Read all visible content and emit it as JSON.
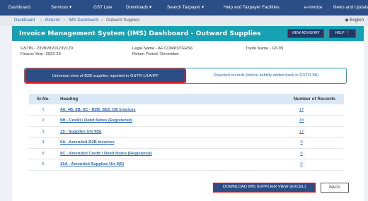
{
  "nav": {
    "items": [
      {
        "label": "Dashboard"
      },
      {
        "label": "Services ▾"
      },
      {
        "label": "GST Law"
      },
      {
        "label": "Downloads ▾"
      },
      {
        "label": "Search Taxpayer ▾"
      },
      {
        "label": "Help and Taxpayer Facilities"
      },
      {
        "label": "e-Invoice"
      },
      {
        "label": "News and Updates"
      }
    ]
  },
  "breadcrumb": {
    "items": [
      "Dashboard",
      "Returns",
      "IMS Dashboard",
      "Outward Supplies"
    ],
    "separator": "›"
  },
  "language": "English",
  "panel": {
    "title": "Invoice Management System (IMS) Dashboard - Outward Supplies",
    "view_advisory": "VIEW ADVISORY",
    "help": "HELP"
  },
  "info": {
    "gstin": "GSTIN - 23V8V8V0123V1Z0",
    "financial_year": "Financi Year -2022-23",
    "legal_name": "Legal Name - AF COMPUTERS6",
    "return_period": "Return Period -December",
    "trade_name": "Trade Name - GSTN"
  },
  "tabs": {
    "active": "Universal view of B2B supplies reported in GSTR-1/1A/IFF",
    "inactive": "Rejected records (where liability added back in GSTR 3B)"
  },
  "table": {
    "headers": {
      "sn": "Sr.No.",
      "heading": "Heading",
      "count": "Number of Records"
    },
    "rows": [
      {
        "sn": "1",
        "heading": "4A, 4B, 6B, 6C - B2B, SEZ, DE Invoices",
        "count": "17"
      },
      {
        "sn": "2",
        "heading": "9B - Credit / Debit Notes (Registered)",
        "count": "18"
      },
      {
        "sn": "3",
        "heading": "15 - Supplies U/s 9(5)",
        "count": "17"
      },
      {
        "sn": "4",
        "heading": "9A - Amended B2B Invoices",
        "count": "0"
      },
      {
        "sn": "5",
        "heading": "9C - Amended Credit / Debit Notes (Registered)",
        "count": "0"
      },
      {
        "sn": "6",
        "heading": "15A - Amended Supplies U/s 9(5)",
        "count": "0"
      }
    ]
  },
  "actions": {
    "download": "DOWNLOAD IMS SUPPLIER VIEW (EXCEL)",
    "back": "BACK"
  },
  "colors": {
    "nav_bg": "#2c4e86",
    "panel_header": "#17a2b4",
    "link": "#2a6ab8",
    "highlight_border": "#d01f2a"
  }
}
